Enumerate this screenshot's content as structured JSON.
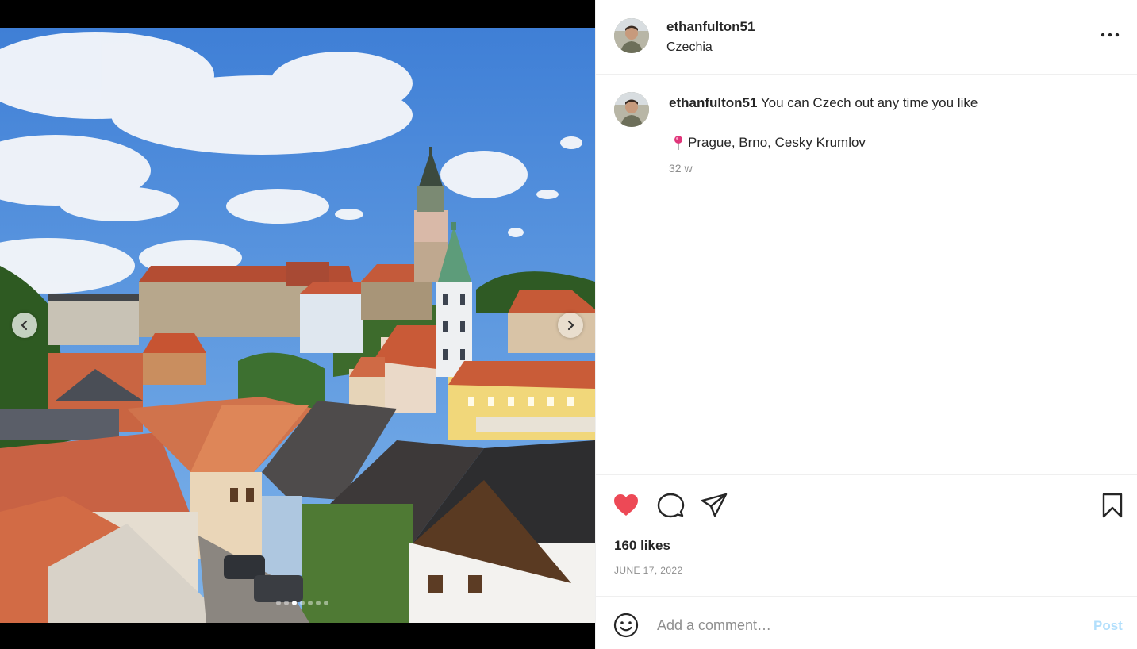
{
  "post": {
    "username": "ethanfulton51",
    "location": "Czechia",
    "caption": "You can Czech out any time you like",
    "caption_location": "Prague, Brno, Cesky Krumlov",
    "time_ago": "32 w",
    "likes": "160 likes",
    "date": "JUNE 17, 2022"
  },
  "carousel": {
    "current_slide": 3,
    "total_slides": 7
  },
  "comment": {
    "placeholder": "Add a comment…",
    "post_label": "Post"
  },
  "icons": {
    "like": "heart-filled-icon",
    "comment": "comment-bubble-icon",
    "share": "paper-plane-icon",
    "save": "bookmark-icon",
    "more": "more-horizontal-icon",
    "emoji": "smiley-icon",
    "pin": "round-pushpin-icon"
  },
  "colors": {
    "like": "#ed4956",
    "post_disabled": "#b2dffc",
    "secondary_text": "#8e8e8e",
    "pin": "#e0367a"
  }
}
